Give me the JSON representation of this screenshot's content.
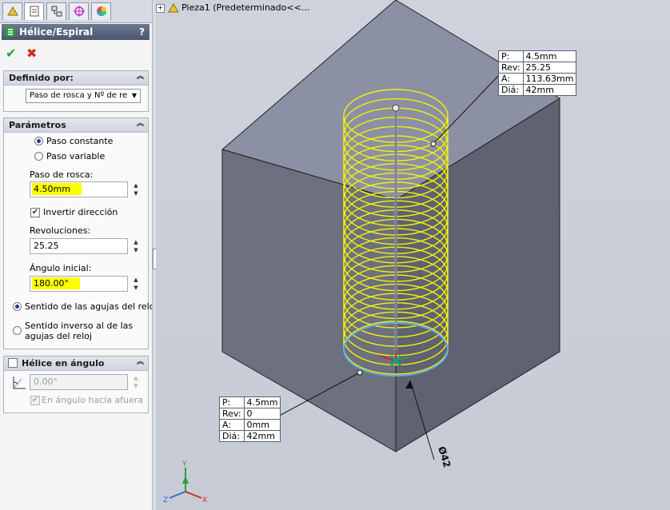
{
  "tabs": [
    {
      "icon": "feature-manager-icon"
    },
    {
      "icon": "property-manager-icon"
    },
    {
      "icon": "configuration-manager-icon"
    },
    {
      "icon": "dimxpert-icon"
    },
    {
      "icon": "display-manager-icon"
    }
  ],
  "property_manager": {
    "title": "Hélice/Espiral",
    "help": "?",
    "ok": "✔",
    "cancel": "✖"
  },
  "defined_by": {
    "title": "Definido por:",
    "selected": "Paso de rosca y Nº de re"
  },
  "parameters": {
    "title": "Parámetros",
    "constant_pitch": "Paso constante",
    "variable_pitch": "Paso variable",
    "pitch_label": "Paso de rosca:",
    "pitch_value": "4.50mm",
    "reverse_direction": "Invertir dirección",
    "revolutions_label": "Revoluciones:",
    "revolutions_value": "25.25",
    "start_angle_label": "Ángulo inicial:",
    "start_angle_value": "180.00°",
    "clockwise": "Sentido de las agujas del reloj",
    "counterclockwise_line1": "Sentido inverso al de las",
    "counterclockwise_line2": "agujas del reloj"
  },
  "taper": {
    "title": "Hélice en ángulo",
    "angle_value": "0.00°",
    "outward": "En ángulo hacia afuera"
  },
  "tree": {
    "plus": "+",
    "part": "Pieza1",
    "config": "(Predeterminado<<..."
  },
  "callout_top": {
    "rows": [
      {
        "k": "P:",
        "v": "4.5mm"
      },
      {
        "k": "Rev:",
        "v": "25.25"
      },
      {
        "k": "A:",
        "v": "113.63mm"
      },
      {
        "k": "Diá:",
        "v": "42mm"
      }
    ]
  },
  "callout_bottom": {
    "rows": [
      {
        "k": "P:",
        "v": "4.5mm"
      },
      {
        "k": "Rev:",
        "v": "0"
      },
      {
        "k": "A:",
        "v": "0mm"
      },
      {
        "k": "Diá:",
        "v": "42mm"
      }
    ]
  },
  "diameter_dim": "Ø42",
  "triad": {
    "x": "X",
    "y": "Y",
    "z": "Z"
  },
  "colors": {
    "helix": "#f2f20a",
    "base_circle": "#5aaee8",
    "cube_top": "#8c90a4",
    "cube_left": "#6d707f",
    "cube_right": "#5f6271",
    "header": "#55607a"
  }
}
